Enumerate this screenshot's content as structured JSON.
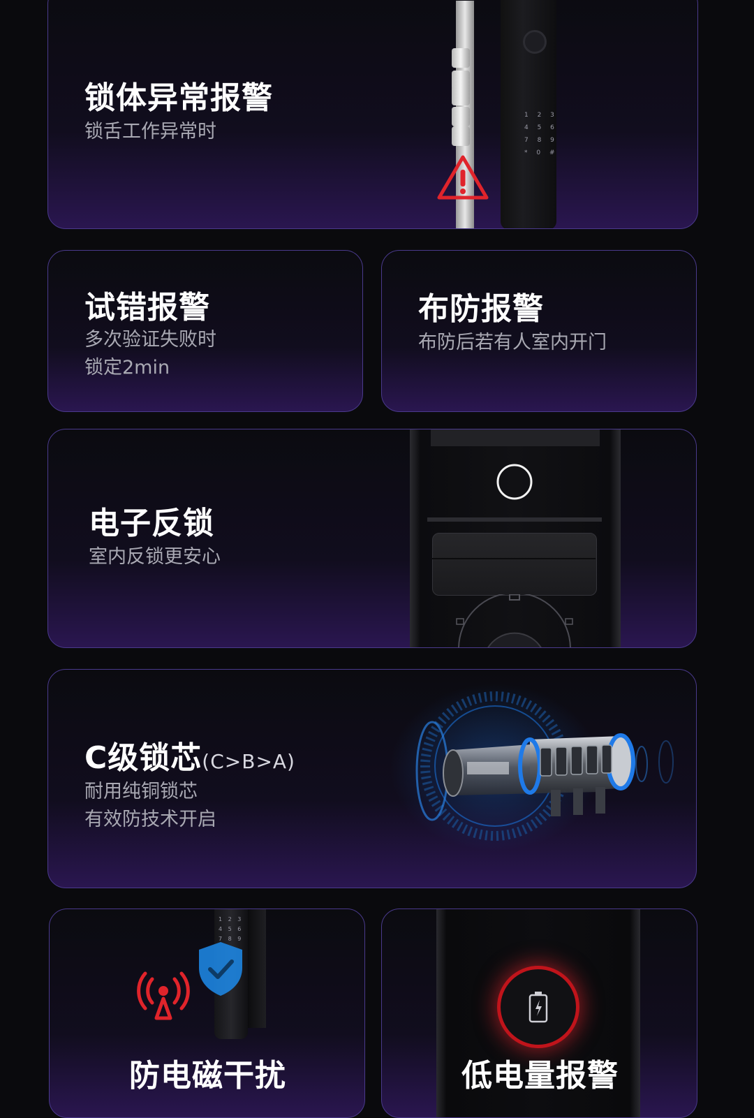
{
  "cards": {
    "lock_body_alarm": {
      "title": "锁体异常报警",
      "subtitle": "锁舌工作异常时",
      "keypad": [
        "1  2  3",
        "4  5  6",
        "7  8  9",
        "*  0  #"
      ]
    },
    "trial_error_alarm": {
      "title": "试错报警",
      "subtitle_lines": [
        "多次验证失败时",
        "锁定2min"
      ]
    },
    "arming_alarm": {
      "title": "布防报警",
      "subtitle": "布防后若有人室内开门"
    },
    "electronic_deadlock": {
      "title": "电子反锁",
      "subtitle": "室内反锁更安心"
    },
    "c_grade_cylinder": {
      "title": "C级锁芯",
      "title_suffix": "(C>B>A)",
      "subtitle_lines": [
        "耐用纯铜锁芯",
        "有效防技术开启"
      ]
    },
    "anti_em_interference": {
      "title": "防电磁干扰"
    },
    "low_battery_alarm": {
      "title": "低电量报警"
    }
  },
  "colors": {
    "card_border": "#4a3a8c",
    "card_glow": "#2a1650",
    "warning_red": "#e0242b",
    "shield_blue": "#1e88e5",
    "cylinder_blue": "#1a6fd6"
  },
  "icons": [
    "warning-triangle-icon",
    "fingerprint-ring-icon",
    "shield-check-icon",
    "signal-alert-icon",
    "battery-icon"
  ]
}
